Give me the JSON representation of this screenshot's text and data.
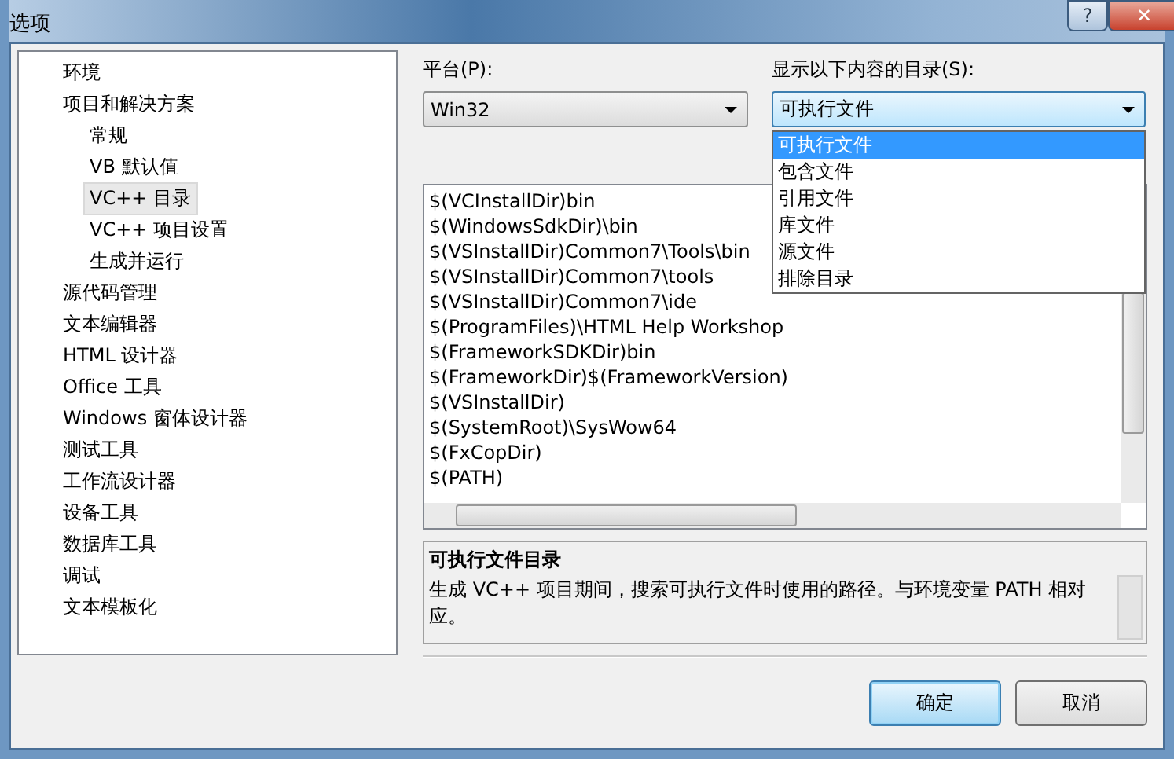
{
  "window": {
    "title": "选项",
    "help_label": "?",
    "close_label": "✕"
  },
  "tree": [
    {
      "label": "环境",
      "selected": false
    },
    {
      "label": "项目和解决方案",
      "selected": false,
      "children": [
        {
          "label": "常规",
          "selected": false
        },
        {
          "label": "VB 默认值",
          "selected": false
        },
        {
          "label": "VC++ 目录",
          "selected": true
        },
        {
          "label": "VC++ 项目设置",
          "selected": false
        },
        {
          "label": "生成并运行",
          "selected": false
        }
      ]
    },
    {
      "label": "源代码管理",
      "selected": false
    },
    {
      "label": "文本编辑器",
      "selected": false
    },
    {
      "label": "HTML 设计器",
      "selected": false
    },
    {
      "label": "Office 工具",
      "selected": false
    },
    {
      "label": "Windows 窗体设计器",
      "selected": false
    },
    {
      "label": "测试工具",
      "selected": false
    },
    {
      "label": "工作流设计器",
      "selected": false
    },
    {
      "label": "设备工具",
      "selected": false
    },
    {
      "label": "数据库工具",
      "selected": false
    },
    {
      "label": "调试",
      "selected": false
    },
    {
      "label": "文本模板化",
      "selected": false
    }
  ],
  "platform": {
    "label": "平台(P):",
    "value": "Win32"
  },
  "directories": {
    "label": "显示以下内容的目录(S):",
    "value": "可执行文件",
    "expanded": true,
    "options": [
      {
        "label": "可执行文件",
        "selected": true
      },
      {
        "label": "包含文件",
        "selected": false
      },
      {
        "label": "引用文件",
        "selected": false
      },
      {
        "label": "库文件",
        "selected": false
      },
      {
        "label": "源文件",
        "selected": false
      },
      {
        "label": "排除目录",
        "selected": false
      }
    ]
  },
  "paths": [
    "$(VCInstallDir)bin",
    "$(WindowsSdkDir)\\bin",
    "$(VSInstallDir)Common7\\Tools\\bin",
    "$(VSInstallDir)Common7\\tools",
    "$(VSInstallDir)Common7\\ide",
    "$(ProgramFiles)\\HTML Help Workshop",
    "$(FrameworkSDKDir)bin",
    "$(FrameworkDir)$(FrameworkVersion)",
    "$(VSInstallDir)",
    "$(SystemRoot)\\SysWow64",
    "$(FxCopDir)",
    "$(PATH)"
  ],
  "description": {
    "title": "可执行文件目录",
    "text": "生成 VC++ 项目期间，搜索可执行文件时使用的路径。与环境变量 PATH 相对应。"
  },
  "buttons": [
    {
      "label": "确定",
      "kind": "default"
    },
    {
      "label": "取消",
      "kind": "normal"
    }
  ]
}
